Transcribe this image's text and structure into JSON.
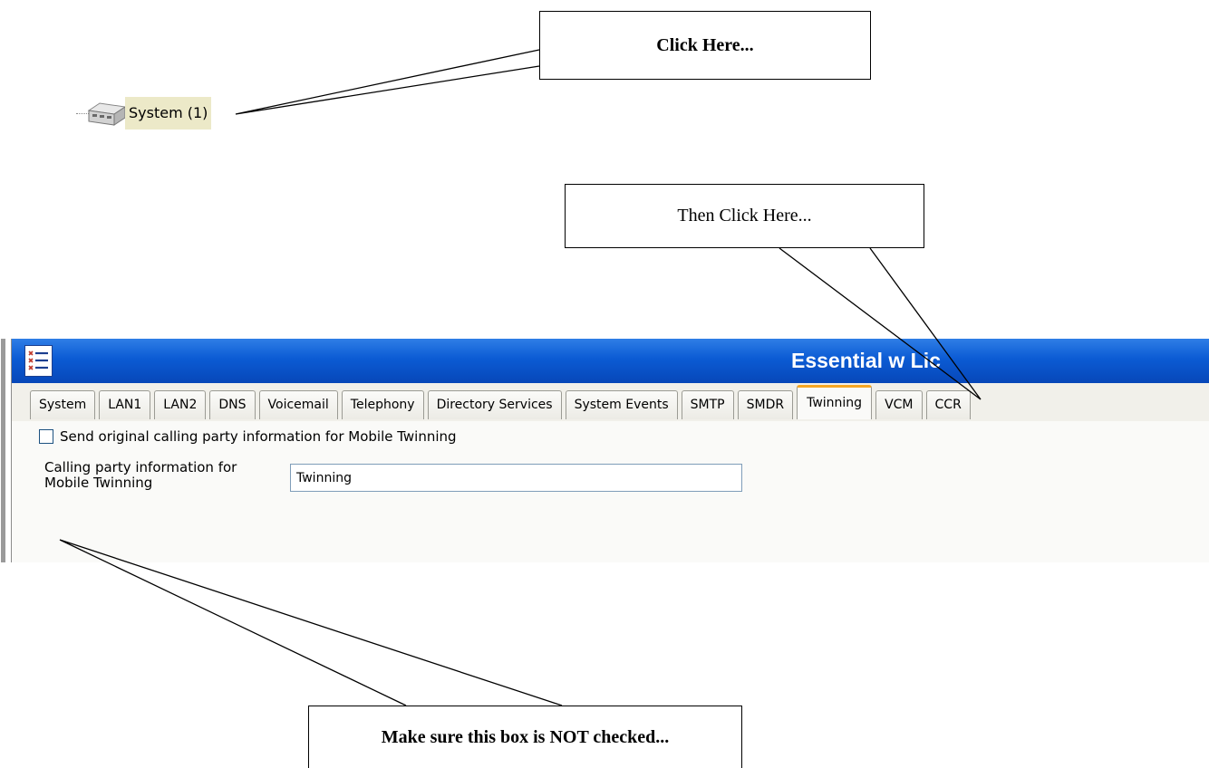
{
  "tree": {
    "system_label": "System (1)",
    "icon": "server-device-icon"
  },
  "callouts": {
    "step1": "Click Here...",
    "step2": "Then Click Here...",
    "step3": "Make sure this box is NOT checked..."
  },
  "window": {
    "title": "Essential w Lic",
    "menu_icon": "list-menu-icon",
    "tabs": [
      {
        "label": "System"
      },
      {
        "label": "LAN1"
      },
      {
        "label": "LAN2"
      },
      {
        "label": "DNS"
      },
      {
        "label": "Voicemail"
      },
      {
        "label": "Telephony"
      },
      {
        "label": "Directory Services"
      },
      {
        "label": "System Events"
      },
      {
        "label": "SMTP"
      },
      {
        "label": "SMDR"
      },
      {
        "label": "Twinning",
        "active": true
      },
      {
        "label": "VCM"
      },
      {
        "label": "CCR"
      }
    ],
    "twinning": {
      "checkbox_label": "Send original calling party information for Mobile Twinning",
      "checkbox_checked": false,
      "field_label": "Calling party information for Mobile Twinning",
      "field_value": "Twinning"
    }
  },
  "colors": {
    "titlebar": "#0b5bd4",
    "active_tab_accent": "#f5a623",
    "tree_highlight": "#ece9c8"
  }
}
